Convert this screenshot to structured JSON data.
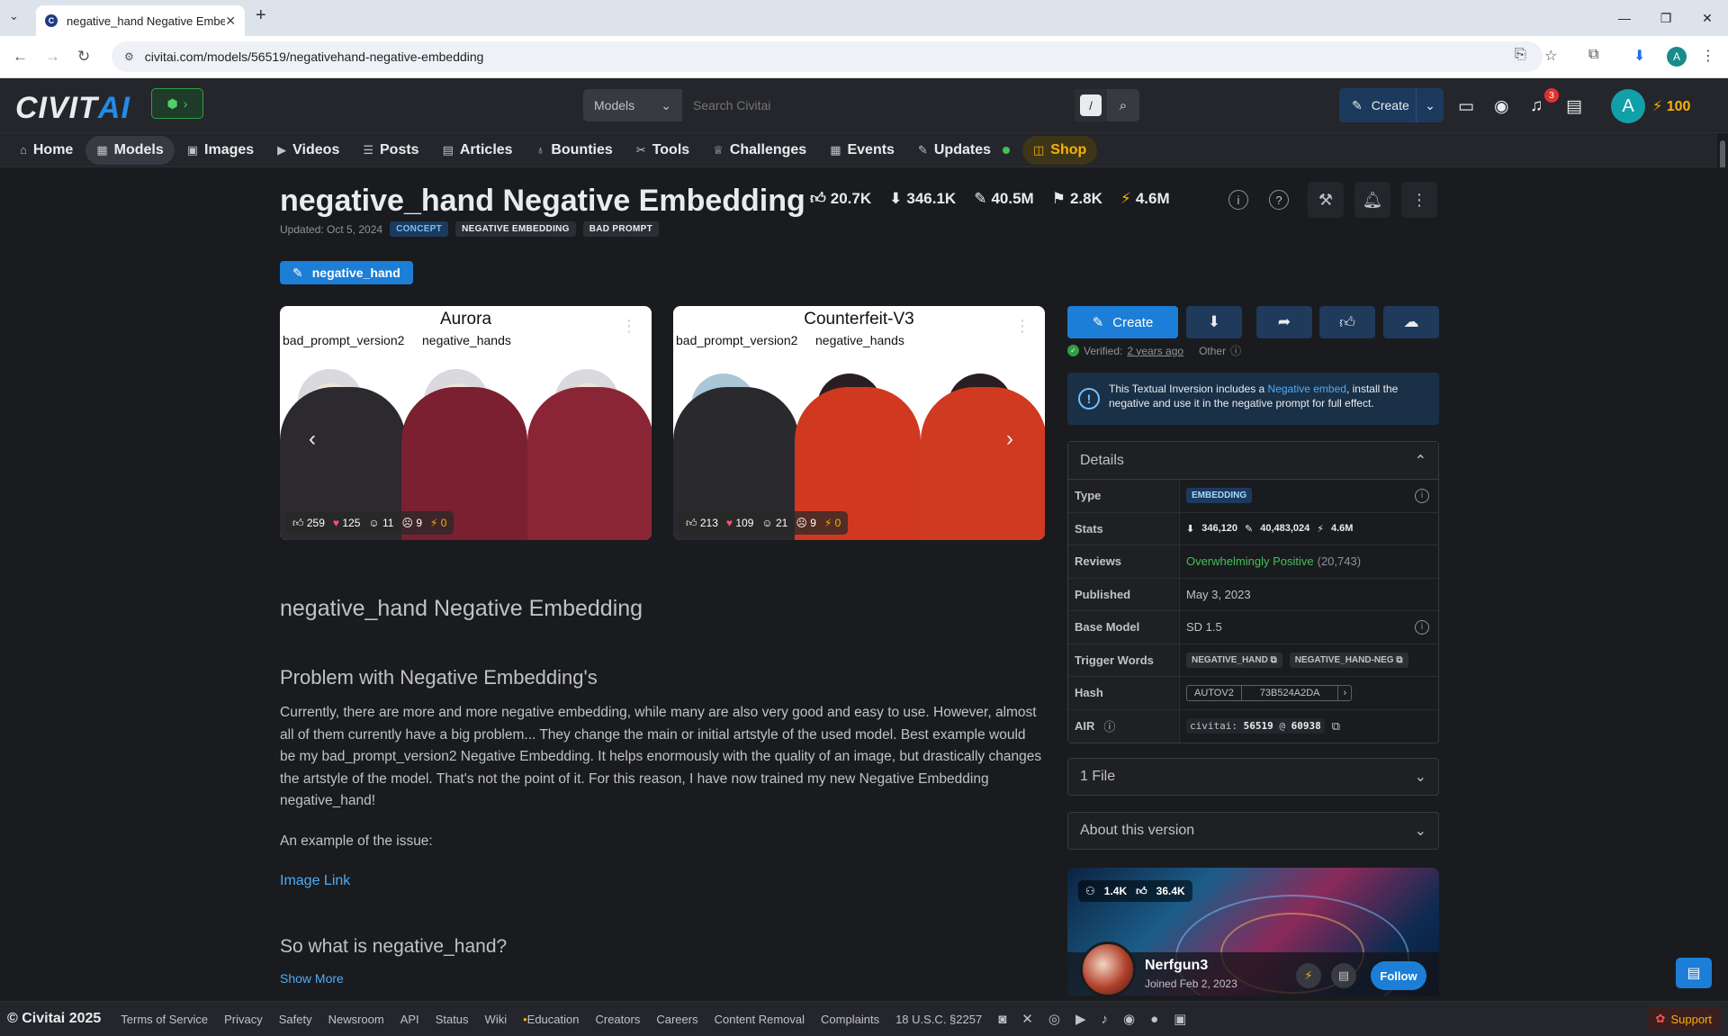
{
  "browser": {
    "tab_title": "negative_hand Negative Embec",
    "url": "civitai.com/models/56519/negativehand-negative-embedding"
  },
  "header": {
    "logo_prefix": "CIVIT",
    "logo_suffix": "AI",
    "search_scope": "Models",
    "search_placeholder": "Search Civitai",
    "search_shortcut": "/",
    "create_label": "Create",
    "notif_count": "3",
    "avatar_letter": "A",
    "buzz": "100"
  },
  "nav": {
    "home": "Home",
    "models": "Models",
    "images": "Images",
    "videos": "Videos",
    "posts": "Posts",
    "articles": "Articles",
    "bounties": "Bounties",
    "tools": "Tools",
    "challenges": "Challenges",
    "events": "Events",
    "updates": "Updates",
    "shop": "Shop"
  },
  "model": {
    "title": "negative_hand Negative Embedding",
    "stats": {
      "likes": "20.7K",
      "downloads": "346.1K",
      "generations": "40.5M",
      "bookmarks": "2.8K",
      "buzz": "4.6M"
    },
    "updated": "Updated: Oct 5, 2024",
    "tags": [
      "CONCEPT",
      "NEGATIVE EMBEDDING",
      "BAD PROMPT"
    ],
    "version_tab": "negative_hand"
  },
  "gallery": [
    {
      "title": "Aurora",
      "label_left": "bad_prompt_version2",
      "label_right": "negative_hands",
      "r_like": "259",
      "r_heart": "125",
      "r_laugh": "11",
      "r_cry": "9",
      "r_buzz": "0"
    },
    {
      "title": "Counterfeit-V3",
      "label_left": "bad_prompt_version2",
      "label_right": "negative_hands",
      "r_like": "213",
      "r_heart": "109",
      "r_laugh": "21",
      "r_cry": "9",
      "r_buzz": "0"
    }
  ],
  "description": {
    "heading": "negative_hand Negative Embedding",
    "sub1": "Problem with Negative Embedding's",
    "para": "Currently, there are more and more negative embedding, while many are also very good and easy to use. However, almost all of them currently have a big problem... They change the main or initial artstyle of the used model. Best example would be my bad_prompt_version2 Negative Embedding. It helps enormously with the quality of an image, but drastically changes the artstyle of the model. That's not the point of it. For this reason, I have now trained my new Negative Embedding negative_hand!",
    "example": "An example of the issue:",
    "link": "Image Link",
    "sub2": "So what is negative_hand?",
    "show_more": "Show More"
  },
  "actions": {
    "create": "Create",
    "verified_prefix": "Verified:",
    "verified_time": "2 years ago",
    "other": "Other"
  },
  "info": {
    "text1": "This Textual Inversion includes a ",
    "link": "Negative embed",
    "text2": ", install the negative and use it in the negative prompt for full effect."
  },
  "details": {
    "header": "Details",
    "type_k": "Type",
    "type_v": "EMBEDDING",
    "stats_k": "Stats",
    "stats_dl": "346,120",
    "stats_gen": "40,483,024",
    "stats_buzz": "4.6M",
    "reviews_k": "Reviews",
    "reviews_v": "Overwhelmingly Positive",
    "reviews_n": "(20,743)",
    "published_k": "Published",
    "published_v": "May 3, 2023",
    "base_k": "Base Model",
    "base_v": "SD 1.5",
    "trigger_k": "Trigger Words",
    "trigger_1": "NEGATIVE_HAND",
    "trigger_2": "NEGATIVE_HAND-NEG",
    "hash_k": "Hash",
    "hash_type": "AUTOV2",
    "hash_v": "73B524A2DA",
    "air_k": "AIR",
    "air_prefix": "civitai:",
    "air_model": "56519",
    "air_at": "@",
    "air_version": "60938"
  },
  "accordions": {
    "files": "1 File",
    "about": "About this version"
  },
  "creator": {
    "followers": "1.4K",
    "likes": "36.4K",
    "name": "Nerfgun3",
    "joined": "Joined Feb 2, 2023",
    "follow": "Follow"
  },
  "footer": {
    "copyright": "© Civitai 2025",
    "links": [
      "Terms of Service",
      "Privacy",
      "Safety",
      "Newsroom",
      "API",
      "Status",
      "Wiki",
      "Education",
      "Creators",
      "Careers",
      "Content Removal",
      "Complaints",
      "18 U.S.C. §2257"
    ],
    "support": "Support"
  }
}
